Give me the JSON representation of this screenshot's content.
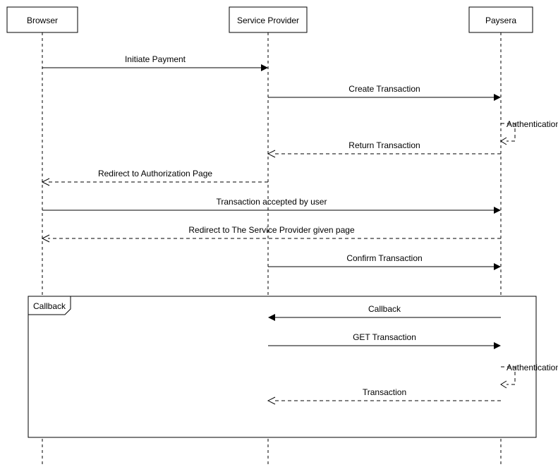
{
  "diagram": {
    "type": "sequence",
    "actors": {
      "browser": "Browser",
      "serviceProvider": "Service Provider",
      "paysera": "Paysera"
    },
    "messages": {
      "m1": "Initiate Payment",
      "m2": "Create Transaction",
      "m3": "Authentication",
      "m4": "Return Transaction",
      "m5": "Redirect to Authorization Page",
      "m6": "Transaction accepted by user",
      "m7": "Redirect to The Service Provider given page",
      "m8": "Confirm Transaction",
      "m9": "Callback",
      "m10": "GET Transaction",
      "m11": "Authentication",
      "m12": "Transaction"
    },
    "fragment": {
      "label": "Callback"
    }
  },
  "chart_data": {
    "type": "sequence-diagram",
    "participants": [
      "Browser",
      "Service Provider",
      "Paysera"
    ],
    "interactions": [
      {
        "from": "Browser",
        "to": "Service Provider",
        "label": "Initiate Payment",
        "style": "solid",
        "direction": "request"
      },
      {
        "from": "Service Provider",
        "to": "Paysera",
        "label": "Create Transaction",
        "style": "solid",
        "direction": "request"
      },
      {
        "from": "Paysera",
        "to": "Paysera",
        "label": "Authentication",
        "style": "dashed",
        "direction": "self"
      },
      {
        "from": "Paysera",
        "to": "Service Provider",
        "label": "Return Transaction",
        "style": "dashed",
        "direction": "return"
      },
      {
        "from": "Service Provider",
        "to": "Browser",
        "label": "Redirect to Authorization Page",
        "style": "dashed",
        "direction": "return"
      },
      {
        "from": "Browser",
        "to": "Paysera",
        "label": "Transaction accepted by user",
        "style": "solid",
        "direction": "request"
      },
      {
        "from": "Paysera",
        "to": "Browser",
        "label": "Redirect to The Service Provider given page",
        "style": "dashed",
        "direction": "return"
      },
      {
        "from": "Service Provider",
        "to": "Paysera",
        "label": "Confirm Transaction",
        "style": "solid",
        "direction": "request"
      },
      {
        "fragment": "Callback",
        "interactions": [
          {
            "from": "Paysera",
            "to": "Service Provider",
            "label": "Callback",
            "style": "solid",
            "direction": "request"
          },
          {
            "from": "Service Provider",
            "to": "Paysera",
            "label": "GET Transaction",
            "style": "solid",
            "direction": "request"
          },
          {
            "from": "Paysera",
            "to": "Paysera",
            "label": "Authentication",
            "style": "dashed",
            "direction": "self"
          },
          {
            "from": "Paysera",
            "to": "Service Provider",
            "label": "Transaction",
            "style": "dashed",
            "direction": "return"
          }
        ]
      }
    ]
  }
}
